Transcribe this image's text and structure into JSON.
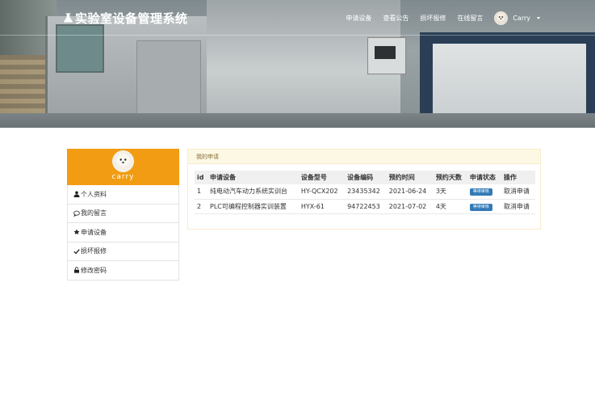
{
  "header": {
    "brand_title": "实验室设备管理系统",
    "nav": [
      "申请设备",
      "查看公告",
      "损坏报修",
      "在线留言"
    ],
    "username": "Carry"
  },
  "sidebar": {
    "profile_name": "carry",
    "items": [
      {
        "label": "个人资料",
        "icon": "user-icon"
      },
      {
        "label": "我的留言",
        "icon": "comment-icon"
      },
      {
        "label": "申请设备",
        "icon": "star-icon"
      },
      {
        "label": "损坏报修",
        "icon": "check-icon"
      },
      {
        "label": "修改密码",
        "icon": "lock-icon"
      }
    ]
  },
  "panel": {
    "title": "我的申请",
    "columns": [
      "id",
      "申请设备",
      "设备型号",
      "设备编码",
      "预约时间",
      "预约天数",
      "申请状态",
      "操作"
    ],
    "rows": [
      {
        "id": "1",
        "device": "纯电动汽车动力系统实训台",
        "model": "HY-QCX202",
        "code": "23435342",
        "date": "2021-06-24",
        "days": "3天",
        "status": "等待审核",
        "action": "取消申请"
      },
      {
        "id": "2",
        "device": "PLC可编程控制器实训装置",
        "model": "HYX-61",
        "code": "94722453",
        "date": "2021-07-02",
        "days": "4天",
        "status": "等待审核",
        "action": "取消申请"
      }
    ]
  },
  "colors": {
    "accent_orange": "#f19c12",
    "badge_blue": "#337ab7",
    "panel_head_bg": "#fcf8e3"
  }
}
